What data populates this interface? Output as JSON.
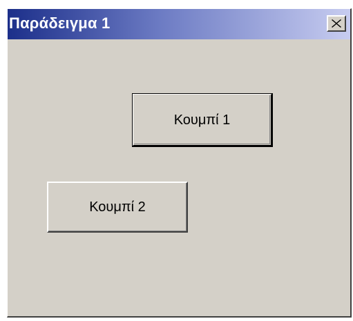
{
  "window": {
    "title": "Παράδειγμα 1"
  },
  "titlebar": {
    "close_icon": "close-icon"
  },
  "buttons": [
    {
      "label": "Κουμπί 1",
      "is_default": true
    },
    {
      "label": "Κουμπί 2",
      "is_default": false
    }
  ],
  "colors": {
    "window_background": "#d4d0c8",
    "titlebar_start": "#1c2f8a",
    "titlebar_end": "#c7ccf0",
    "title_text": "#ffffff"
  }
}
